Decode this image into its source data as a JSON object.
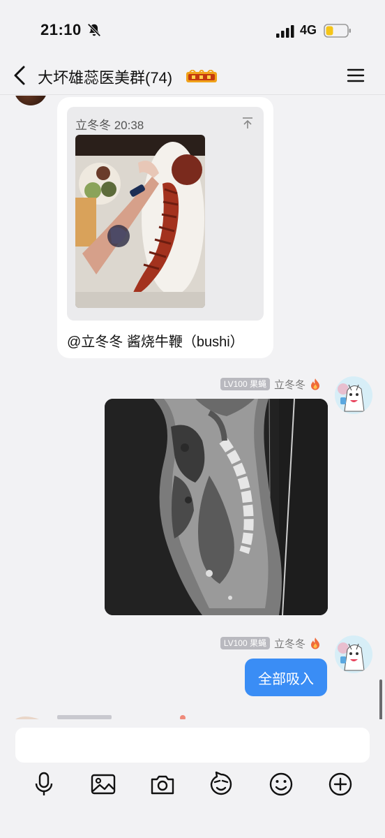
{
  "status": {
    "time": "21:10",
    "network": "4G"
  },
  "header": {
    "title": "大坏雄蕊医美群(74)"
  },
  "messages": {
    "quote_card": {
      "quoted_meta": "立冬冬 20:38",
      "text": "@立冬冬 酱烧牛鞭（bushi）"
    },
    "self_1": {
      "level": "LV100 果蝇",
      "nickname": "立冬冬"
    },
    "self_2": {
      "level": "LV100 果蝇",
      "nickname": "立冬冬",
      "text": "全部吸入"
    }
  },
  "colors": {
    "accent_blue": "#3a8df5",
    "background": "#f2f2f4",
    "badge_gray": "#b9b9bf"
  },
  "toolbar_icons": [
    "microphone-icon",
    "image-icon",
    "camera-icon",
    "sticker-icon",
    "emoji-icon",
    "plus-icon"
  ]
}
